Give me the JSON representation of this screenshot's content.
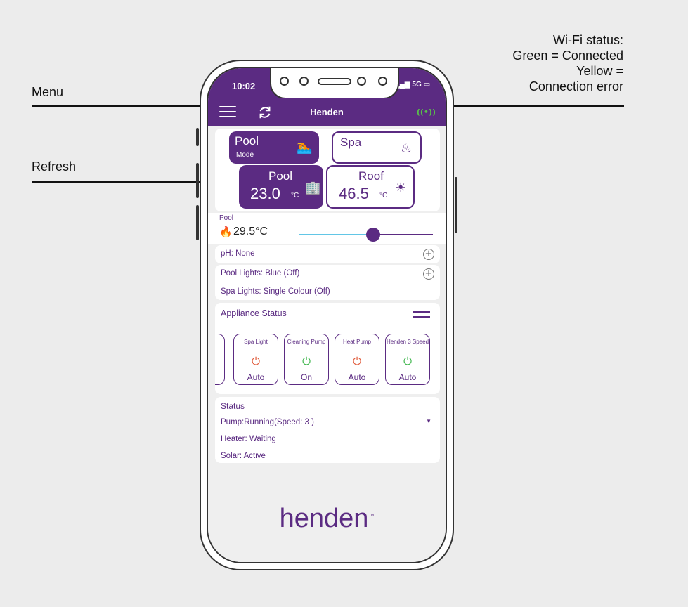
{
  "callouts": {
    "menu": "Menu",
    "refresh": "Refresh",
    "wifi_line1": "Wi-Fi status:",
    "wifi_line2": "Green = Connected",
    "wifi_line3": "Yellow =",
    "wifi_line4": "Connection error"
  },
  "statusbar": {
    "time": "10:02",
    "signal": "5G"
  },
  "appbar": {
    "title": "Henden",
    "wifi_symbol": "((•))"
  },
  "mode_tiles": {
    "pool": {
      "label": "Pool",
      "sub": "Mode",
      "icon": "swimmer-icon"
    },
    "spa": {
      "label": "Spa",
      "icon": "hot-tub-icon"
    }
  },
  "temp_tiles": {
    "pool": {
      "label": "Pool",
      "value": "23.0",
      "unit": "°C"
    },
    "roof": {
      "label": "Roof",
      "value": "46.5",
      "unit": "°C"
    }
  },
  "setpoint": {
    "label": "Pool",
    "value": "29.5°C",
    "level": 0.55
  },
  "rows": {
    "ph": "pH: None",
    "pool_lights": "Pool Lights: Blue (Off)",
    "spa_lights": "Spa Lights: Single Colour (Off)"
  },
  "appliance": {
    "title": "Appliance Status",
    "items": [
      {
        "name": "Spa Light",
        "state": "Auto",
        "color": "#e05a3a"
      },
      {
        "name": "Cleaning Pump",
        "state": "On",
        "color": "#3bb54a"
      },
      {
        "name": "Heat Pump",
        "state": "Auto",
        "color": "#e05a3a"
      },
      {
        "name": "Henden 3 Speed",
        "state": "Auto",
        "color": "#3bb54a"
      }
    ]
  },
  "status": {
    "title": "Status",
    "pump": "Pump:Running(Speed: 3 )",
    "heater": "Heater:  Waiting",
    "solar": "Solar: Active"
  },
  "logo": {
    "text": "henden",
    "tm": "™"
  },
  "colors": {
    "brand": "#5b2b82",
    "wifi_ok": "#59c14a",
    "slider_left": "#62c6e6"
  }
}
